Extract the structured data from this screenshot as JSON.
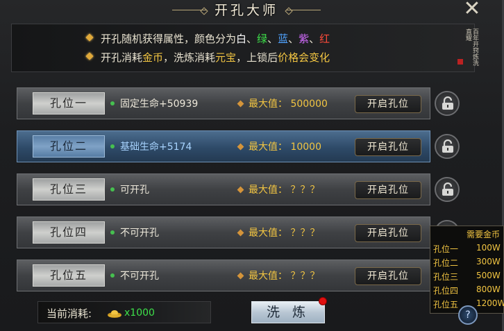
{
  "title": "开孔大师",
  "close_symbol": "✕",
  "info": {
    "line1": {
      "prefix": "开孔随机获得属性，颜色分为",
      "colors": [
        "白",
        "绿",
        "蓝",
        "紫",
        "红"
      ],
      "sep": "、"
    },
    "line2": {
      "p1": "开孔消耗",
      "gold": "金币",
      "p2": "，洗炼消耗",
      "yuanbao": "元宝",
      "p3": "，上锁后",
      "price_change": "价格会变化"
    },
    "seal_text": "百年开窍炼洗直耀"
  },
  "rows": [
    {
      "label": "孔位一",
      "attr": "固定生命+50939",
      "max_label": "最大值：",
      "max_value": "500000",
      "button": "开启孔位",
      "selected": false
    },
    {
      "label": "孔位二",
      "attr": "基础生命+5174",
      "max_label": "最大值：",
      "max_value": "10000",
      "button": "开启孔位",
      "selected": true
    },
    {
      "label": "孔位三",
      "attr": "可开孔",
      "max_label": "最大值：",
      "max_value": "？？？",
      "button": "开启孔位",
      "selected": false
    },
    {
      "label": "孔位四",
      "attr": "不可开孔",
      "max_label": "最大值：",
      "max_value": "？？？",
      "button": "开启孔位",
      "selected": false
    },
    {
      "label": "孔位五",
      "attr": "不可开孔",
      "max_label": "最大值：",
      "max_value": "？？？",
      "button": "开启孔位",
      "selected": false
    }
  ],
  "cost": {
    "label": "当前消耗:",
    "value": "x1000"
  },
  "refine_button": "洗 炼",
  "price_table": {
    "header": "需要金币",
    "rows": [
      {
        "name": "孔位一",
        "value": "100W"
      },
      {
        "name": "孔位二",
        "value": "300W"
      },
      {
        "name": "孔位三",
        "value": "500W"
      },
      {
        "name": "孔位四",
        "value": "800W"
      },
      {
        "name": "孔位五",
        "value": "1200W"
      }
    ]
  },
  "help_symbol": "?",
  "colors": {
    "accent_gold": "#f2c542",
    "attr_green": "#3ee04a",
    "selected_blue": "#2e4a68",
    "notification_red": "#e01010"
  },
  "icons": {
    "close": "close-icon",
    "lock": "unlock-icon",
    "ingot": "gold-ingot-icon",
    "help": "help-icon"
  }
}
